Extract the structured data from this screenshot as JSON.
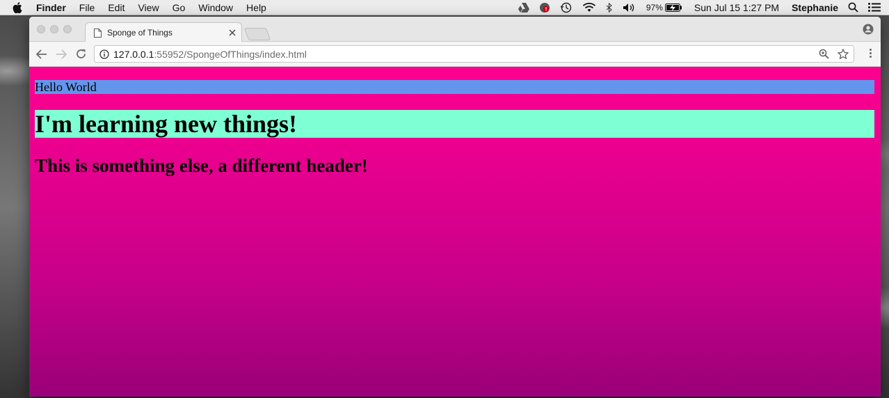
{
  "menubar": {
    "app_name": "Finder",
    "menus": [
      "File",
      "Edit",
      "View",
      "Go",
      "Window",
      "Help"
    ],
    "battery": "97%",
    "datetime": "Sun Jul 15  1:27 PM",
    "user": "Stephanie"
  },
  "browser": {
    "tab_title": "Sponge of Things",
    "url_host": "127.0.0.1",
    "url_path": ":55952/SpongeOfThings/index.html"
  },
  "page": {
    "paragraph": "Hello World",
    "heading1": "I'm learning new things!",
    "heading2": "This is something else, a different header!"
  },
  "colors": {
    "page_gradient_top": "#ff0090",
    "page_gradient_bottom": "#9a0078",
    "paragraph_bg": "#6495ed",
    "heading1_bg": "#7fffd4"
  }
}
